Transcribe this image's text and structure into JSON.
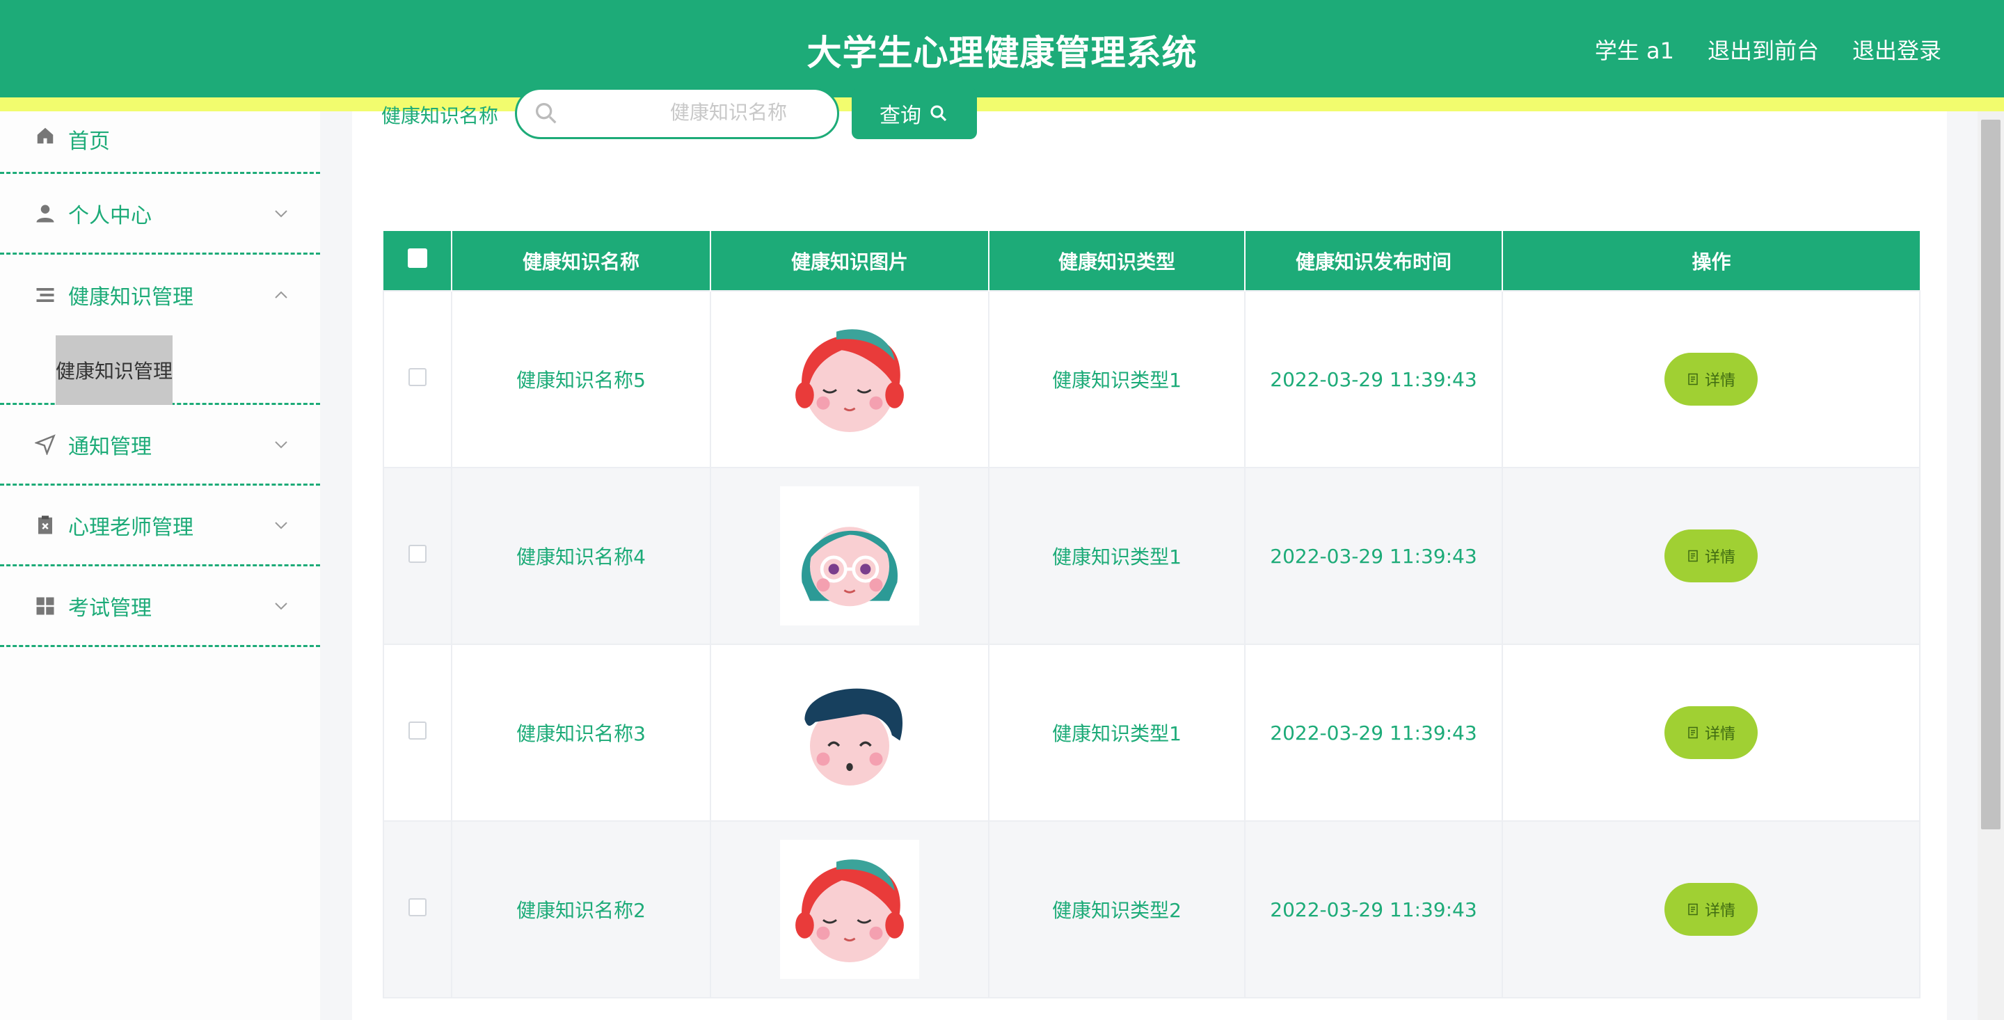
{
  "header": {
    "title": "大学生心理健康管理系统",
    "user": "学生 a1",
    "front_link": "退出到前台",
    "logout_link": "退出登录"
  },
  "sidebar": {
    "items": [
      {
        "label": "首页",
        "icon": "home-icon"
      },
      {
        "label": "个人中心",
        "icon": "user-icon"
      },
      {
        "label": "健康知识管理",
        "icon": "list-icon",
        "sub": "健康知识管理"
      },
      {
        "label": "通知管理",
        "icon": "send-icon"
      },
      {
        "label": "心理老师管理",
        "icon": "clipboard-icon"
      },
      {
        "label": "考试管理",
        "icon": "grid-icon"
      }
    ]
  },
  "search": {
    "label": "健康知识名称",
    "placeholder": "健康知识名称",
    "button": "查询"
  },
  "table": {
    "columns": [
      "健康知识名称",
      "健康知识图片",
      "健康知识类型",
      "健康知识发布时间",
      "操作"
    ],
    "rows": [
      {
        "name": "健康知识名称5",
        "type": "健康知识类型1",
        "time": "2022-03-29 11:39:43",
        "action": "详情",
        "avatar": "red-hair-girl"
      },
      {
        "name": "健康知识名称4",
        "type": "健康知识类型1",
        "time": "2022-03-29 11:39:43",
        "action": "详情",
        "avatar": "teal-hair-glasses"
      },
      {
        "name": "健康知识名称3",
        "type": "健康知识类型1",
        "time": "2022-03-29 11:39:43",
        "action": "详情",
        "avatar": "navy-hair-boy"
      },
      {
        "name": "健康知识名称2",
        "type": "健康知识类型2",
        "time": "2022-03-29 11:39:43",
        "action": "详情",
        "avatar": "red-hair-girl"
      }
    ]
  },
  "colors": {
    "primary": "#1dab78",
    "accent_stripe": "#f2fc6e",
    "detail_button": "#a0d033"
  }
}
